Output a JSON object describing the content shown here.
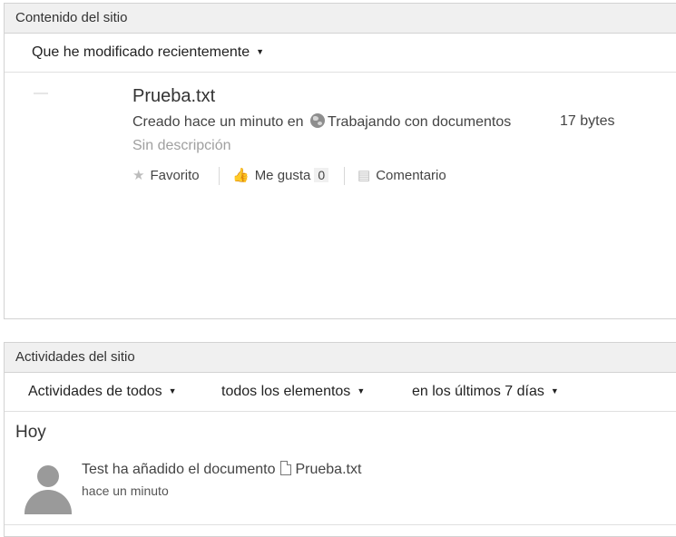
{
  "site_content": {
    "title": "Contenido del sitio",
    "filter": "Que he modificado recientemente",
    "document": {
      "name": "Prueba.txt",
      "created_prefix": "Creado hace un minuto en",
      "site": "Trabajando con documentos",
      "size": "17 bytes",
      "description": "Sin descripción"
    },
    "actions": {
      "favorite": "Favorito",
      "like": "Me gusta",
      "like_count": "0",
      "comment": "Comentario"
    }
  },
  "site_activities": {
    "title": "Actividades del sitio",
    "filters": {
      "who": "Actividades de todos",
      "what": "todos los elementos",
      "when": "en los últimos 7 días"
    },
    "group_label": "Hoy",
    "items": [
      {
        "text": "Test ha añadido el documento",
        "doc": "Prueba.txt",
        "time": "hace un minuto"
      }
    ]
  },
  "icons": {
    "caret": "caret-down-icon",
    "star": "star-icon",
    "thumb": "thumbs-up-icon",
    "comment": "comment-icon",
    "globe": "globe-icon",
    "file": "file-icon",
    "avatar": "avatar-icon"
  }
}
